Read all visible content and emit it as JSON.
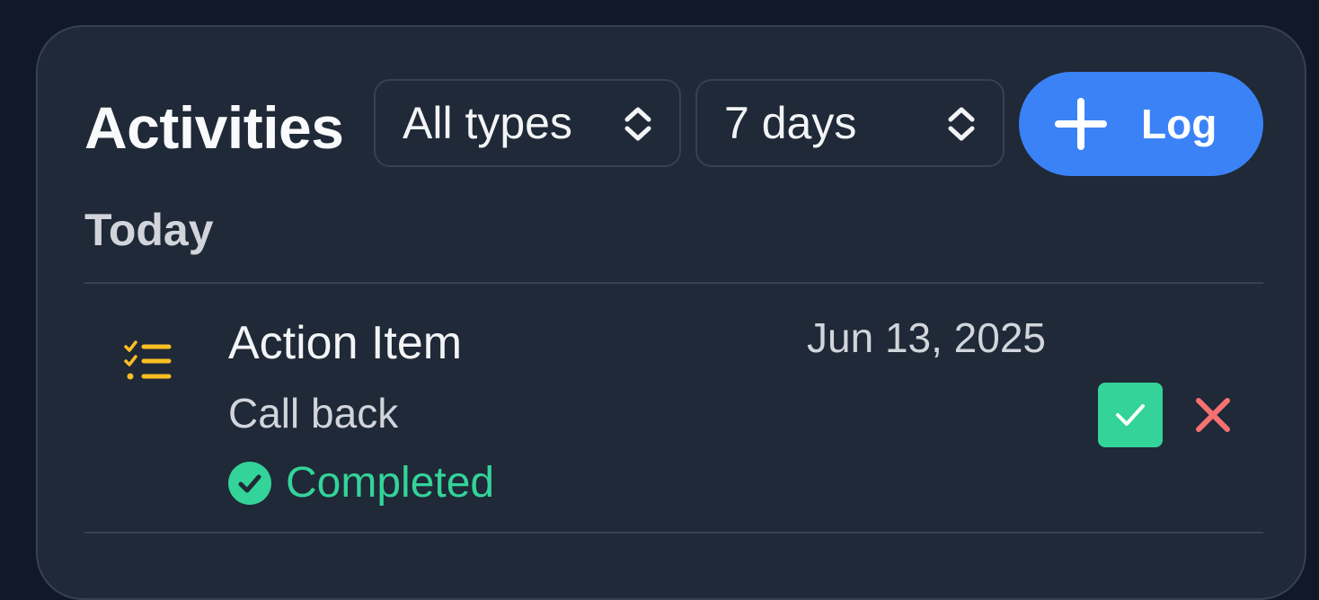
{
  "header": {
    "title": "Activities",
    "type_filter": {
      "selected": "All types",
      "icon": "chevron-up-down-icon"
    },
    "period_filter": {
      "selected": "7 days",
      "icon": "chevron-up-down-icon"
    },
    "log_button": {
      "label": "Log",
      "icon": "plus-icon"
    }
  },
  "groups": [
    {
      "label": "Today",
      "items": [
        {
          "type": "Action Item",
          "type_icon": "checklist-icon",
          "date": "Jun 13, 2025",
          "description": "Call back",
          "status": "Completed",
          "status_icon": "check-circle-icon",
          "actions": {
            "complete_icon": "check-icon",
            "delete_icon": "close-icon"
          }
        }
      ]
    }
  ],
  "colors": {
    "background": "#111827",
    "panel": "#1f2937",
    "border": "#374151",
    "accent": "#3b82f6",
    "success": "#34d399",
    "danger": "#f87171",
    "icon_warning": "#fbbf24"
  }
}
